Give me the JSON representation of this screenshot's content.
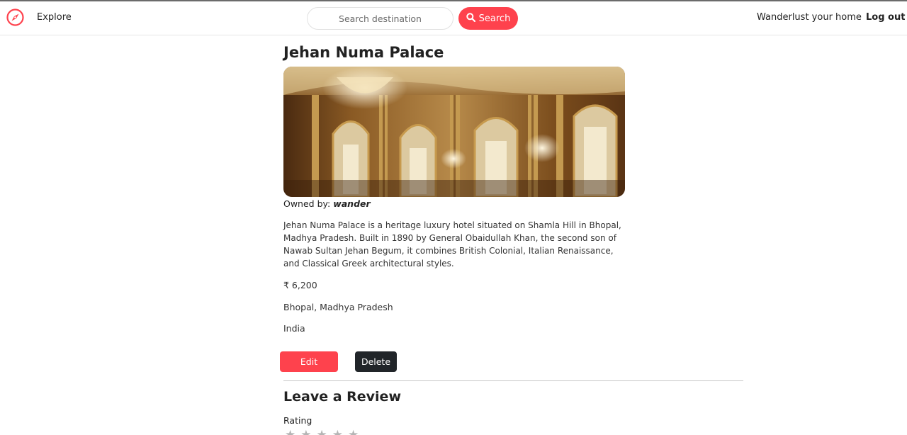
{
  "nav": {
    "explore": "Explore",
    "search_placeholder": "Search destination",
    "search_button": "Search",
    "home": "Wanderlust your home",
    "logout": "Log out"
  },
  "listing": {
    "title": "Jehan Numa Palace",
    "owned_label": "Owned by: ",
    "owner": "wander",
    "description": "Jehan Numa Palace is a heritage luxury hotel situated on Shamla Hill in Bhopal, Madhya Pradesh. Built in 1890 by General Obaidullah Khan, the second son of Nawab Sultan Jehan Begum, it combines British Colonial, Italian Renaissance, and Classical Greek architectural styles.",
    "price": "₹ 6,200",
    "location": "Bhopal, Madhya Pradesh",
    "country": "India"
  },
  "actions": {
    "edit": "Edit",
    "delete": "Delete"
  },
  "review": {
    "heading": "Leave a Review",
    "rating_label": "Rating",
    "stars": [
      "★",
      "★",
      "★",
      "★",
      "★"
    ]
  },
  "colors": {
    "accent": "#fe424d",
    "dark_button": "#212529"
  },
  "icons": {
    "brand": "compass-icon",
    "search": "search-icon"
  }
}
